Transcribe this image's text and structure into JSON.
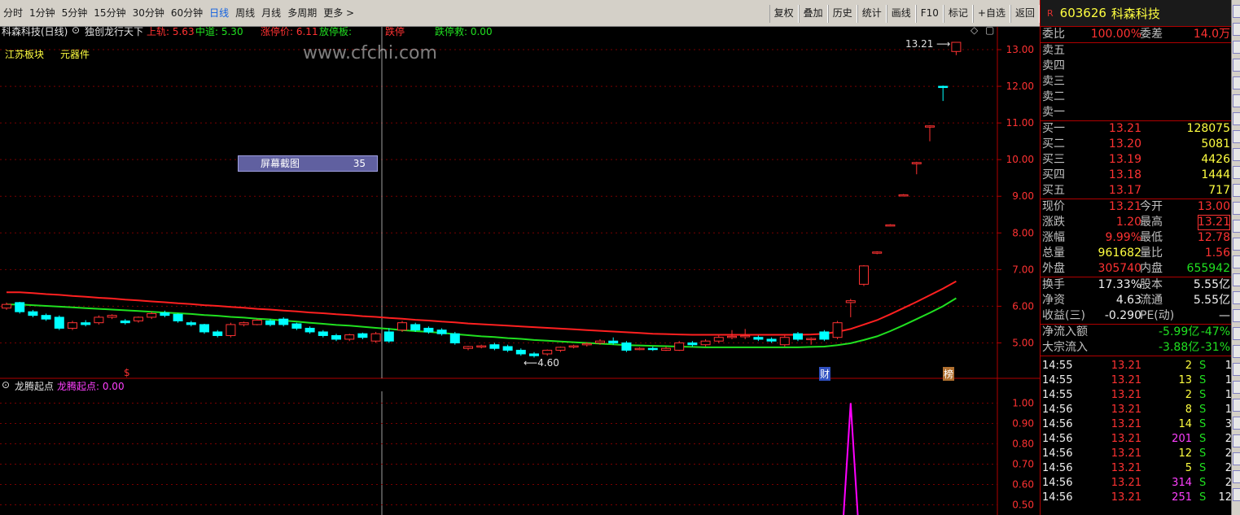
{
  "toolbar": {
    "periods": [
      "分时",
      "1分钟",
      "5分钟",
      "15分钟",
      "30分钟",
      "60分钟",
      "日线",
      "周线",
      "月线",
      "多周期",
      "更多 >"
    ],
    "active_period": "日线",
    "tools": [
      "复权",
      "叠加",
      "历史",
      "统计",
      "画线",
      "F10",
      "标记",
      "+自选",
      "返回"
    ]
  },
  "chart_header": {
    "stock_name": "科森科技(日线)",
    "indicator_name": "独创龙行天下",
    "upper_label": "上轨: 5.63",
    "middle_label": "中道: 5.30",
    "limit_up_label": "涨停价: 6.11",
    "signal_label": "放停板:",
    "signal2_label": "跌停",
    "limit_down_label": "跌停救: 0.00",
    "watermark": "www.cfchi.com"
  },
  "tags": {
    "region": "江苏板块",
    "sector": "元器件"
  },
  "screenshot_box": {
    "label": "屏幕截图",
    "value": "35"
  },
  "annotations": {
    "high_label": "13.21",
    "low_label": "4.60",
    "marker_s": "$",
    "marker_cai": "财",
    "marker_bang": "榜"
  },
  "sub_panel": {
    "name": "龙腾起点",
    "label": "龙腾起点: 0.00"
  },
  "colors": {
    "up": "#ff3232",
    "down": "#00ffff",
    "ma_red": "#ff2020",
    "ma_green": "#20e020",
    "indicator": "#ff00ff",
    "grid": "#800000"
  },
  "chart_data": {
    "type": "candlestick",
    "ylim": [
      4.3,
      13.4
    ],
    "y_ticks": [
      "13.00",
      "12.00",
      "11.00",
      "10.00",
      "9.00",
      "8.00",
      "7.00",
      "6.00",
      "5.00"
    ],
    "candles": [
      [
        5.95,
        6.05,
        5.9,
        6.1
      ],
      [
        6.1,
        5.85,
        5.8,
        6.12
      ],
      [
        5.85,
        5.75,
        5.7,
        5.9
      ],
      [
        5.75,
        5.65,
        5.6,
        5.8
      ],
      [
        5.7,
        5.4,
        5.35,
        5.75
      ],
      [
        5.4,
        5.55,
        5.35,
        5.6
      ],
      [
        5.55,
        5.5,
        5.45,
        5.62
      ],
      [
        5.55,
        5.7,
        5.5,
        5.75
      ],
      [
        5.7,
        5.75,
        5.65,
        5.78
      ],
      [
        5.6,
        5.55,
        5.5,
        5.65
      ],
      [
        5.6,
        5.7,
        5.55,
        5.72
      ],
      [
        5.7,
        5.8,
        5.65,
        5.85
      ],
      [
        5.82,
        5.75,
        5.7,
        5.88
      ],
      [
        5.78,
        5.6,
        5.55,
        5.8
      ],
      [
        5.55,
        5.5,
        5.45,
        5.6
      ],
      [
        5.5,
        5.3,
        5.25,
        5.52
      ],
      [
        5.3,
        5.2,
        5.15,
        5.35
      ],
      [
        5.2,
        5.5,
        5.15,
        5.55
      ],
      [
        5.5,
        5.55,
        5.45,
        5.58
      ],
      [
        5.5,
        5.62,
        5.48,
        5.65
      ],
      [
        5.6,
        5.5,
        5.45,
        5.65
      ],
      [
        5.65,
        5.5,
        5.45,
        5.7
      ],
      [
        5.52,
        5.4,
        5.35,
        5.55
      ],
      [
        5.4,
        5.3,
        5.25,
        5.45
      ],
      [
        5.3,
        5.2,
        5.15,
        5.35
      ],
      [
        5.2,
        5.1,
        5.05,
        5.25
      ],
      [
        5.1,
        5.22,
        5.05,
        5.25
      ],
      [
        5.25,
        5.15,
        5.1,
        5.28
      ],
      [
        5.05,
        5.25,
        5.0,
        5.3
      ],
      [
        5.3,
        5.05,
        5.0,
        5.4
      ],
      [
        5.35,
        5.55,
        5.3,
        5.6
      ],
      [
        5.5,
        5.35,
        5.3,
        5.55
      ],
      [
        5.4,
        5.3,
        5.25,
        5.45
      ],
      [
        5.35,
        5.25,
        5.2,
        5.4
      ],
      [
        5.25,
        5.0,
        4.95,
        5.3
      ],
      [
        4.85,
        4.9,
        4.8,
        4.92
      ],
      [
        4.9,
        4.92,
        4.85,
        4.95
      ],
      [
        4.95,
        4.85,
        4.8,
        5.0
      ],
      [
        4.9,
        4.8,
        4.75,
        4.95
      ],
      [
        4.8,
        4.7,
        4.65,
        4.85
      ],
      [
        4.7,
        4.65,
        4.6,
        4.75
      ],
      [
        4.7,
        4.8,
        4.65,
        4.82
      ],
      [
        4.8,
        4.88,
        4.75,
        4.9
      ],
      [
        4.9,
        4.92,
        4.85,
        4.95
      ],
      [
        4.95,
        4.98,
        4.9,
        5.02
      ],
      [
        5.0,
        5.05,
        4.95,
        5.1
      ],
      [
        5.05,
        5.0,
        4.95,
        5.15
      ],
      [
        5.0,
        4.8,
        4.75,
        5.05
      ],
      [
        4.82,
        4.85,
        4.8,
        4.88
      ],
      [
        4.85,
        4.82,
        4.78,
        4.9
      ],
      [
        4.8,
        4.85,
        4.78,
        4.9
      ],
      [
        4.8,
        5.0,
        4.78,
        5.05
      ],
      [
        5.0,
        4.95,
        4.9,
        5.05
      ],
      [
        4.95,
        5.05,
        4.9,
        5.1
      ],
      [
        5.05,
        5.15,
        5.0,
        5.2
      ],
      [
        5.15,
        5.18,
        5.1,
        5.35
      ],
      [
        5.18,
        5.2,
        5.1,
        5.38
      ],
      [
        5.15,
        5.1,
        5.05,
        5.2
      ],
      [
        5.1,
        5.05,
        5.0,
        5.15
      ],
      [
        4.95,
        5.15,
        4.9,
        5.2
      ],
      [
        5.25,
        5.1,
        5.05,
        5.3
      ],
      [
        5.1,
        5.12,
        4.95,
        5.15
      ],
      [
        5.3,
        5.1,
        5.05,
        5.35
      ],
      [
        5.15,
        5.55,
        5.1,
        5.6
      ],
      [
        6.1,
        6.15,
        5.7,
        6.2
      ],
      [
        6.6,
        7.1,
        6.55,
        7.12
      ],
      [
        7.45,
        7.48,
        7.42,
        7.5
      ],
      [
        8.2,
        8.22,
        8.18,
        8.24
      ],
      [
        9.02,
        9.04,
        9.0,
        9.06
      ],
      [
        9.9,
        9.92,
        9.6,
        9.94
      ],
      [
        10.9,
        10.92,
        10.5,
        10.94
      ],
      [
        12.0,
        11.98,
        11.6,
        12.02
      ],
      [
        12.95,
        13.2,
        12.85,
        13.21
      ]
    ],
    "ma_red": [
      6.38,
      6.38,
      6.36,
      6.33,
      6.31,
      6.28,
      6.26,
      6.23,
      6.21,
      6.18,
      6.16,
      6.13,
      6.11,
      6.08,
      6.06,
      6.03,
      6.01,
      5.98,
      5.96,
      5.93,
      5.91,
      5.88,
      5.86,
      5.83,
      5.81,
      5.78,
      5.76,
      5.73,
      5.71,
      5.68,
      5.66,
      5.63,
      5.61,
      5.58,
      5.56,
      5.53,
      5.51,
      5.49,
      5.47,
      5.45,
      5.43,
      5.41,
      5.39,
      5.37,
      5.35,
      5.33,
      5.31,
      5.29,
      5.27,
      5.25,
      5.24,
      5.23,
      5.22,
      5.22,
      5.22,
      5.22,
      5.22,
      5.22,
      5.22,
      5.22,
      5.22,
      5.23,
      5.25,
      5.3,
      5.38,
      5.5,
      5.62,
      5.78,
      5.95,
      6.12,
      6.3,
      6.48,
      6.68
    ],
    "ma_green": [
      6.05,
      6.05,
      6.03,
      6.01,
      5.99,
      5.97,
      5.95,
      5.93,
      5.91,
      5.89,
      5.87,
      5.85,
      5.83,
      5.81,
      5.79,
      5.76,
      5.74,
      5.71,
      5.69,
      5.66,
      5.64,
      5.61,
      5.58,
      5.55,
      5.52,
      5.49,
      5.47,
      5.44,
      5.41,
      5.38,
      5.35,
      5.32,
      5.3,
      5.27,
      5.24,
      5.21,
      5.18,
      5.16,
      5.13,
      5.11,
      5.08,
      5.06,
      5.04,
      5.02,
      5.0,
      4.98,
      4.96,
      4.94,
      4.93,
      4.92,
      4.91,
      4.9,
      4.89,
      4.88,
      4.88,
      4.88,
      4.88,
      4.88,
      4.88,
      4.88,
      4.88,
      4.89,
      4.9,
      4.94,
      4.99,
      5.08,
      5.18,
      5.32,
      5.48,
      5.65,
      5.82,
      6.0,
      6.22
    ],
    "sub_panel": {
      "ylim": [
        0.45,
        1.05
      ],
      "y_ticks": [
        "1.00",
        "0.90",
        "0.80",
        "0.70",
        "0.60",
        "0.50"
      ],
      "spike_index": 64,
      "spike_value": 1.0
    }
  },
  "quote": {
    "code": "603626",
    "name": "科森科技",
    "r_badge": "R",
    "weibi_label": "委比",
    "weibi_value": "100.00%",
    "weicha_label": "委差",
    "weicha_value": "14.0万",
    "sells": [
      {
        "label": "卖五",
        "price": "",
        "vol": ""
      },
      {
        "label": "卖四",
        "price": "",
        "vol": ""
      },
      {
        "label": "卖三",
        "price": "",
        "vol": ""
      },
      {
        "label": "卖二",
        "price": "",
        "vol": ""
      },
      {
        "label": "卖一",
        "price": "",
        "vol": ""
      }
    ],
    "buys": [
      {
        "label": "买一",
        "price": "13.21",
        "vol": "128075"
      },
      {
        "label": "买二",
        "price": "13.20",
        "vol": "5081"
      },
      {
        "label": "买三",
        "price": "13.19",
        "vol": "4426"
      },
      {
        "label": "买四",
        "price": "13.18",
        "vol": "1444"
      },
      {
        "label": "买五",
        "price": "13.17",
        "vol": "717"
      }
    ],
    "stats": [
      {
        "l1": "现价",
        "v1": "13.21",
        "l2": "今开",
        "v2": "13.00"
      },
      {
        "l1": "涨跌",
        "v1": "1.20",
        "l2": "最高",
        "v2": "13.21"
      },
      {
        "l1": "涨幅",
        "v1": "9.99%",
        "l2": "最低",
        "v2": "12.78"
      },
      {
        "l1": "总量",
        "v1": "961682",
        "l2": "量比",
        "v2": "1.56"
      },
      {
        "l1": "外盘",
        "v1": "305740",
        "l2": "内盘",
        "v2": "655942"
      }
    ],
    "stats2": [
      {
        "l1": "换手",
        "v1": "17.33%",
        "l2": "股本",
        "v2": "5.55亿"
      },
      {
        "l1": "净资",
        "v1": "4.63",
        "l2": "流通",
        "v2": "5.55亿"
      },
      {
        "l1": "收益(三)",
        "v1": "-0.290",
        "l2": "PE(动)",
        "v2": "—"
      }
    ],
    "flows": [
      {
        "label": "净流入额",
        "value": "-5.99亿",
        "pct": "-47%"
      },
      {
        "label": "大宗流入",
        "value": "-3.88亿",
        "pct": "-31%"
      }
    ],
    "trades": [
      {
        "time": "14:55",
        "price": "13.21",
        "vol": "2",
        "side": "S",
        "n": "1"
      },
      {
        "time": "14:55",
        "price": "13.21",
        "vol": "13",
        "side": "S",
        "n": "1"
      },
      {
        "time": "14:55",
        "price": "13.21",
        "vol": "2",
        "side": "S",
        "n": "1"
      },
      {
        "time": "14:56",
        "price": "13.21",
        "vol": "8",
        "side": "S",
        "n": "1"
      },
      {
        "time": "14:56",
        "price": "13.21",
        "vol": "14",
        "side": "S",
        "n": "3"
      },
      {
        "time": "14:56",
        "price": "13.21",
        "vol": "201",
        "side": "S",
        "n": "2"
      },
      {
        "time": "14:56",
        "price": "13.21",
        "vol": "12",
        "side": "S",
        "n": "2"
      },
      {
        "time": "14:56",
        "price": "13.21",
        "vol": "5",
        "side": "S",
        "n": "2"
      },
      {
        "time": "14:56",
        "price": "13.21",
        "vol": "314",
        "side": "S",
        "n": "2"
      },
      {
        "time": "14:56",
        "price": "13.21",
        "vol": "251",
        "side": "S",
        "n": "12"
      }
    ]
  }
}
